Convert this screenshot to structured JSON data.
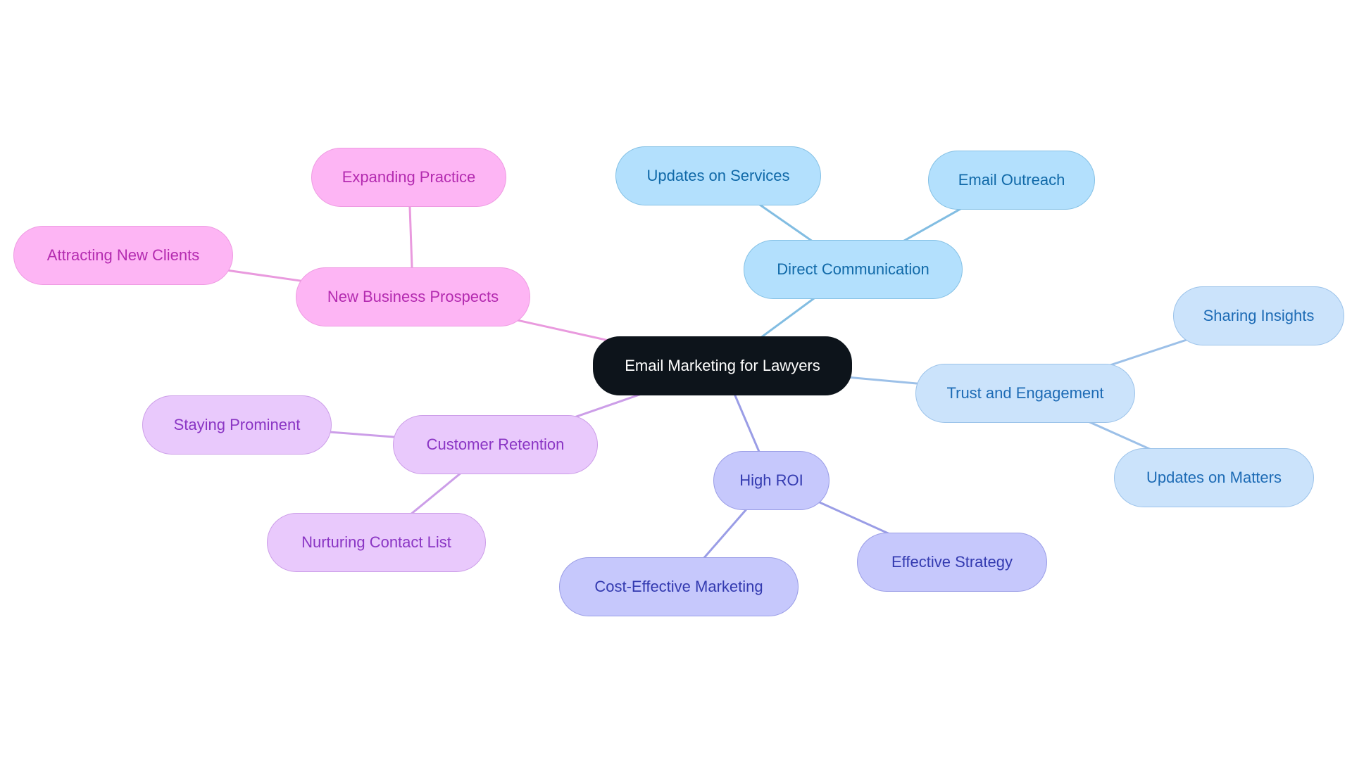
{
  "diagram": {
    "type": "mindmap",
    "root": {
      "id": "root",
      "label": "Email Marketing for Lawyers"
    },
    "branches": [
      {
        "id": "new-business",
        "label": "New Business Prospects",
        "theme": "pink",
        "children": [
          {
            "id": "expanding",
            "label": "Expanding Practice"
          },
          {
            "id": "attracting",
            "label": "Attracting New Clients"
          }
        ]
      },
      {
        "id": "direct-comm",
        "label": "Direct Communication",
        "theme": "sky",
        "children": [
          {
            "id": "updates-services",
            "label": "Updates on Services"
          },
          {
            "id": "email-outreach",
            "label": "Email Outreach"
          }
        ]
      },
      {
        "id": "trust",
        "label": "Trust and Engagement",
        "theme": "lightblue",
        "children": [
          {
            "id": "sharing",
            "label": "Sharing Insights"
          },
          {
            "id": "updates-matters",
            "label": "Updates on Matters"
          }
        ]
      },
      {
        "id": "high-roi",
        "label": "High ROI",
        "theme": "indigo",
        "children": [
          {
            "id": "effective",
            "label": "Effective Strategy"
          },
          {
            "id": "cost-effective",
            "label": "Cost-Effective Marketing"
          }
        ]
      },
      {
        "id": "retention",
        "label": "Customer Retention",
        "theme": "purple",
        "children": [
          {
            "id": "staying",
            "label": "Staying Prominent"
          },
          {
            "id": "nurturing",
            "label": "Nurturing Contact List"
          }
        ]
      }
    ],
    "themes": {
      "root": {
        "fill": "#0d141b",
        "stroke": "#0d141b",
        "text": "#ffffff",
        "edge": "#0d141b"
      },
      "pink": {
        "fill": "#fdb5f4",
        "stroke": "#ee9be2",
        "text": "#b42bb0",
        "edge": "#e99ade"
      },
      "sky": {
        "fill": "#b3e0fd",
        "stroke": "#85c1e5",
        "text": "#1069a8",
        "edge": "#82bde2"
      },
      "lightblue": {
        "fill": "#cbe3fb",
        "stroke": "#9cc3ea",
        "text": "#1d6bb5",
        "edge": "#9cc0e8"
      },
      "indigo": {
        "fill": "#c6c8fc",
        "stroke": "#9a9de6",
        "text": "#333ab0",
        "edge": "#9a9de6"
      },
      "purple": {
        "fill": "#e9c9fc",
        "stroke": "#cc9ee8",
        "text": "#8a35c4",
        "edge": "#cc9ee8"
      }
    }
  }
}
